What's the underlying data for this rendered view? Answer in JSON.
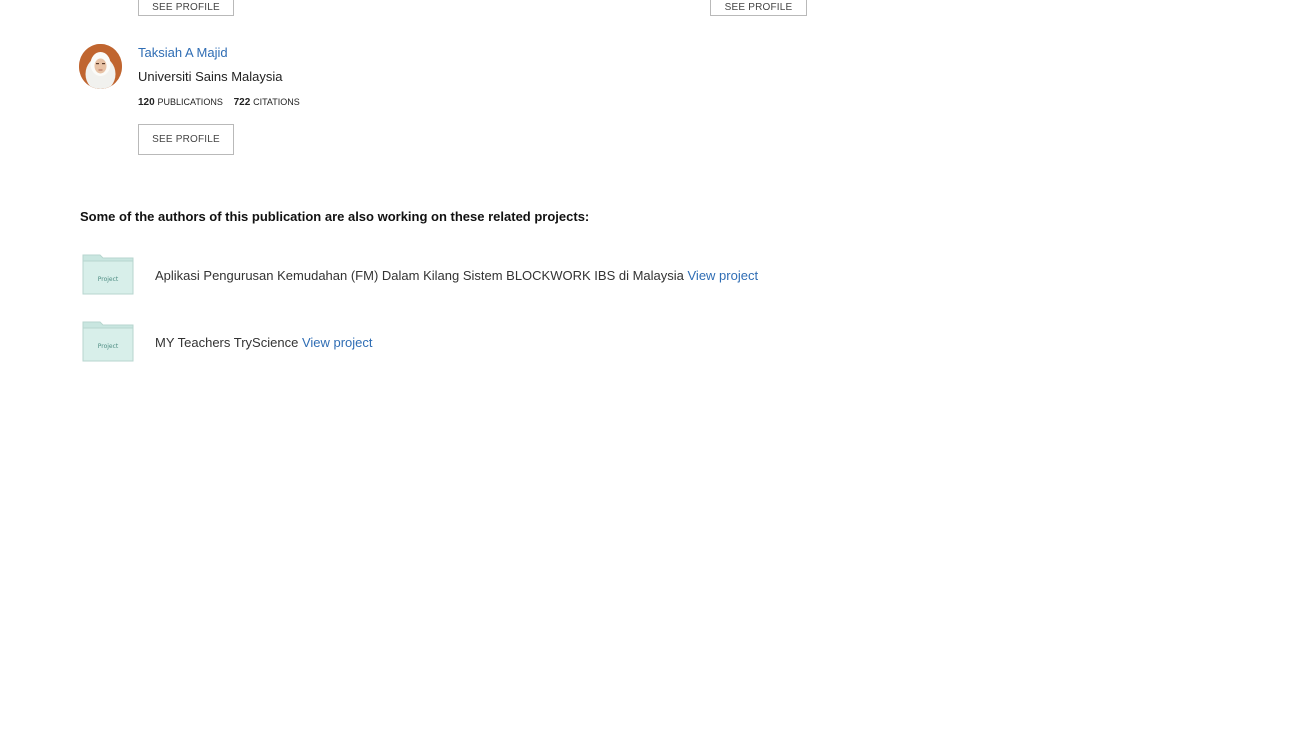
{
  "top_buttons": {
    "left_label": "SEE PROFILE",
    "right_label": "SEE PROFILE"
  },
  "author": {
    "name": "Taksiah A Majid",
    "institution": "Universiti Sains Malaysia",
    "publications_count": "120",
    "publications_label": "PUBLICATIONS",
    "citations_count": "722",
    "citations_label": "CITATIONS",
    "see_profile_label": "SEE PROFILE"
  },
  "related": {
    "heading": "Some of the authors of this publication are also working on these related projects:",
    "projects": [
      {
        "icon": "project-folder-icon",
        "icon_label": "Project",
        "title": "Aplikasi Pengurusan Kemudahan (FM) Dalam Kilang Sistem BLOCKWORK IBS di Malaysia",
        "link": "View project"
      },
      {
        "icon": "project-folder-icon",
        "icon_label": "Project",
        "title": "MY Teachers TryScience",
        "link": "View project"
      }
    ]
  },
  "colors": {
    "link": "#2f6db4",
    "folder": "#cfe9e4",
    "border": "#b9b9b9"
  }
}
